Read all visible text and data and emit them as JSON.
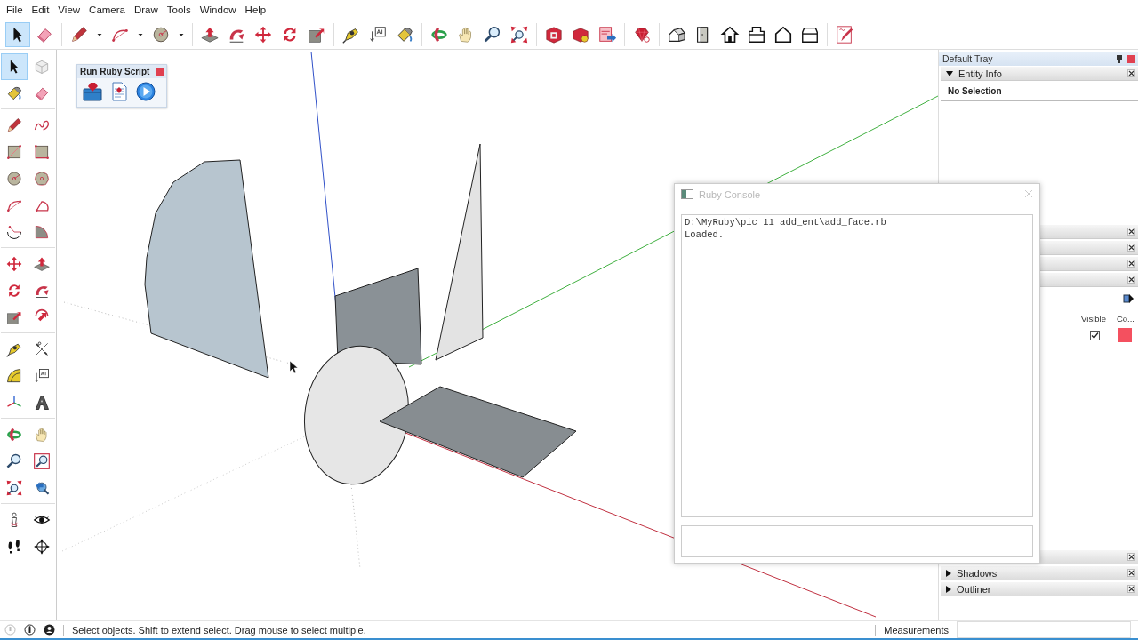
{
  "menu": [
    "File",
    "Edit",
    "View",
    "Camera",
    "Draw",
    "Tools",
    "Window",
    "Help"
  ],
  "toolbar": {
    "tools": [
      {
        "selected": true
      },
      {
        "selected": false
      },
      {
        "selected": false
      },
      {
        "selected": false
      },
      {
        "selected": false
      },
      {
        "selected": false
      },
      {
        "selected": false
      },
      {
        "selected": false
      },
      {
        "selected": false
      },
      {
        "selected": false
      },
      {
        "selected": false
      },
      {
        "selected": false
      },
      {
        "selected": false
      },
      {
        "selected": false
      },
      {
        "selected": false
      },
      {
        "selected": false
      },
      {
        "selected": false
      },
      {
        "selected": false
      },
      {
        "selected": false
      },
      {
        "selected": false
      },
      {
        "selected": false
      },
      {
        "selected": false
      },
      {
        "selected": false
      },
      {
        "selected": false
      },
      {
        "selected": false
      },
      {
        "selected": false
      },
      {
        "selected": false
      },
      {
        "selected": false
      },
      {
        "selected": false
      },
      {
        "selected": false
      },
      {
        "selected": false
      }
    ]
  },
  "left_toolbar": {
    "tools": [
      {
        "selected": true
      },
      {
        "selected": false
      },
      {
        "selected": false
      },
      {
        "selected": false
      },
      {
        "selected": false
      },
      {
        "selected": false
      },
      {
        "selected": false
      },
      {
        "selected": false
      },
      {
        "selected": false
      },
      {
        "selected": false
      },
      {
        "selected": false
      },
      {
        "selected": false
      },
      {
        "selected": false
      },
      {
        "selected": false
      },
      {
        "selected": false
      },
      {
        "selected": false
      },
      {
        "selected": false
      },
      {
        "selected": false
      },
      {
        "selected": false
      },
      {
        "selected": false
      },
      {
        "selected": false
      },
      {
        "selected": false
      },
      {
        "selected": false
      },
      {
        "selected": false
      },
      {
        "selected": false
      },
      {
        "selected": false
      },
      {
        "selected": false
      },
      {
        "selected": false
      },
      {
        "selected": false
      },
      {
        "selected": false
      },
      {
        "selected": false
      },
      {
        "selected": false
      },
      {
        "selected": false
      },
      {
        "selected": false
      },
      {
        "selected": false
      },
      {
        "selected": false
      }
    ]
  },
  "ruby_toolbar": {
    "title": "Run Ruby Script"
  },
  "tray": {
    "title": "Default Tray",
    "panels": [
      {
        "kind": "section",
        "label": "Entity Info",
        "expanded": true,
        "body": "No Selection"
      },
      {
        "kind": "section"
      },
      {
        "kind": "section"
      },
      {
        "kind": "section"
      },
      {
        "kind": "section"
      },
      {
        "kind": "layers",
        "columns": [
          "Visible",
          "Co..."
        ],
        "rows": [
          {
            "visible": true,
            "color": "#f4505f"
          }
        ]
      },
      {
        "kind": "section"
      },
      {
        "kind": "section",
        "label": "Shadows",
        "expanded": false
      },
      {
        "kind": "section",
        "label": "Outliner",
        "expanded": false
      }
    ]
  },
  "console": {
    "title": "Ruby Console",
    "output": [
      "D:\\MyRuby\\pic 11 add_ent\\add_face.rb",
      "Loaded."
    ]
  },
  "status_bar": {
    "message": "Select objects. Shift to extend select. Drag mouse to select multiple.",
    "measurements_label": "Measurements"
  }
}
